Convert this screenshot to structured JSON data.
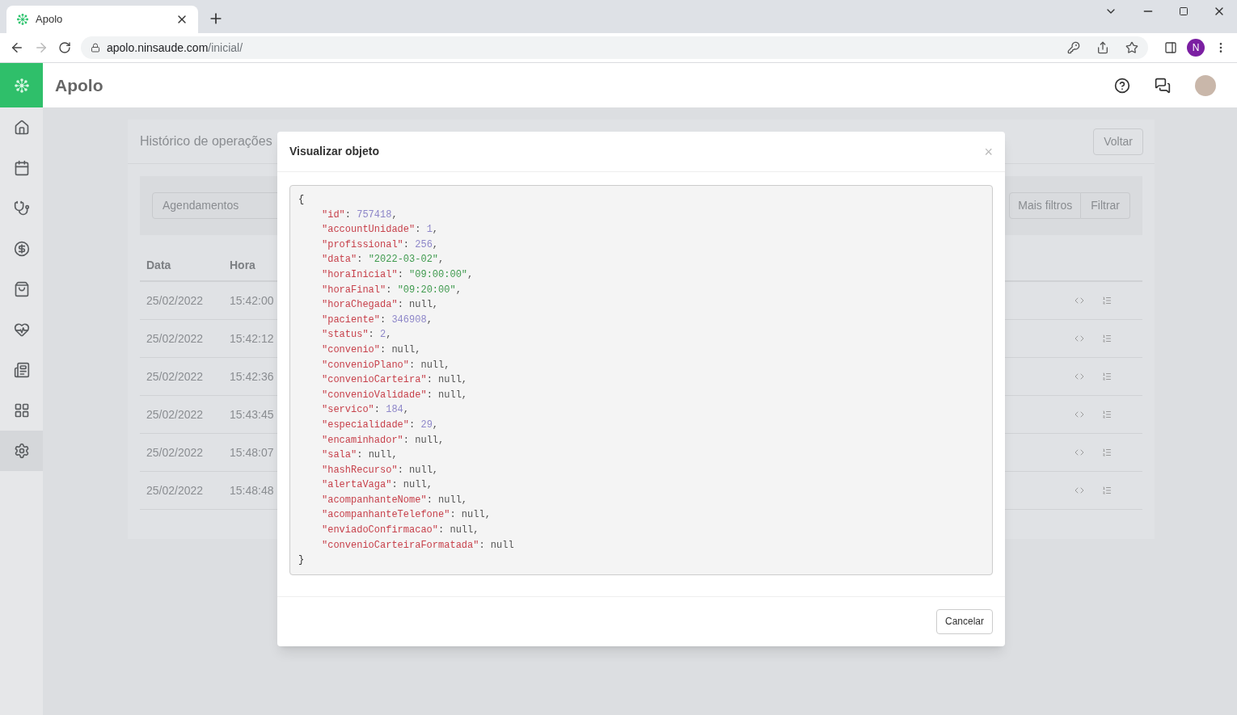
{
  "browser": {
    "tab": {
      "title": "Apolo",
      "selected": true
    },
    "url_host": "apolo.ninsaude.com",
    "url_path": "/inicial/",
    "profile_initial": "N"
  },
  "app": {
    "name": "Apolo"
  },
  "sidebar": {
    "items": [
      {
        "kind": "home",
        "selected": false
      },
      {
        "kind": "calendar",
        "selected": false
      },
      {
        "kind": "stethoscope",
        "selected": false
      },
      {
        "kind": "dollar",
        "selected": false
      },
      {
        "kind": "bag",
        "selected": false
      },
      {
        "kind": "heart",
        "selected": false
      },
      {
        "kind": "news",
        "selected": false
      },
      {
        "kind": "grid",
        "selected": false
      },
      {
        "kind": "settings",
        "selected": true
      }
    ]
  },
  "page": {
    "title": "Histórico de operações",
    "back_button": "Voltar",
    "filter_select": "Agendamentos",
    "more_filters_button": "Mais filtros",
    "filter_button": "Filtrar",
    "table": {
      "columns": [
        "Data",
        "Hora"
      ],
      "rows": [
        {
          "date": "25/02/2022",
          "time": "15:42:00"
        },
        {
          "date": "25/02/2022",
          "time": "15:42:12"
        },
        {
          "date": "25/02/2022",
          "time": "15:42:36"
        },
        {
          "date": "25/02/2022",
          "time": "15:43:45"
        },
        {
          "date": "25/02/2022",
          "time": "15:48:07"
        },
        {
          "date": "25/02/2022",
          "time": "15:48:48"
        }
      ]
    }
  },
  "modal": {
    "title": "Visualizar objeto",
    "close": "×",
    "cancel_button": "Cancelar",
    "open": "{",
    "close_brace": "}",
    "lines": [
      {
        "key": "\"id\"",
        "sep": ":",
        "value": "757418",
        "kind": "number",
        "end": ","
      },
      {
        "key": "\"accountUnidade\"",
        "sep": ":",
        "value": "1",
        "kind": "number",
        "end": ","
      },
      {
        "key": "\"profissional\"",
        "sep": ":",
        "value": "256",
        "kind": "number",
        "end": ","
      },
      {
        "key": "\"data\"",
        "sep": ":",
        "value": "\"2022-03-02\"",
        "kind": "string",
        "end": ","
      },
      {
        "key": "\"horaInicial\"",
        "sep": ":",
        "value": "\"09:00:00\"",
        "kind": "string",
        "end": ","
      },
      {
        "key": "\"horaFinal\"",
        "sep": ":",
        "value": "\"09:20:00\"",
        "kind": "string",
        "end": ","
      },
      {
        "key": "\"horaChegada\"",
        "sep": ":",
        "value": "null",
        "kind": "null",
        "end": ","
      },
      {
        "key": "\"paciente\"",
        "sep": ":",
        "value": "346908",
        "kind": "number",
        "end": ","
      },
      {
        "key": "\"status\"",
        "sep": ":",
        "value": "2",
        "kind": "number",
        "end": ","
      },
      {
        "key": "\"convenio\"",
        "sep": ":",
        "value": "null",
        "kind": "null",
        "end": ","
      },
      {
        "key": "\"convenioPlano\"",
        "sep": ":",
        "value": "null",
        "kind": "null",
        "end": ","
      },
      {
        "key": "\"convenioCarteira\"",
        "sep": ":",
        "value": "null",
        "kind": "null",
        "end": ","
      },
      {
        "key": "\"convenioValidade\"",
        "sep": ":",
        "value": "null",
        "kind": "null",
        "end": ","
      },
      {
        "key": "\"servico\"",
        "sep": ":",
        "value": "184",
        "kind": "number",
        "end": ","
      },
      {
        "key": "\"especialidade\"",
        "sep": ":",
        "value": "29",
        "kind": "number",
        "end": ","
      },
      {
        "key": "\"encaminhador\"",
        "sep": ":",
        "value": "null",
        "kind": "null",
        "end": ","
      },
      {
        "key": "\"sala\"",
        "sep": ":",
        "value": "null",
        "kind": "null",
        "end": ","
      },
      {
        "key": "\"hashRecurso\"",
        "sep": ":",
        "value": "null",
        "kind": "null",
        "end": ","
      },
      {
        "key": "\"alertaVaga\"",
        "sep": ":",
        "value": "null",
        "kind": "null",
        "end": ","
      },
      {
        "key": "\"acompanhanteNome\"",
        "sep": ":",
        "value": "null",
        "kind": "null",
        "end": ","
      },
      {
        "key": "\"acompanhanteTelefone\"",
        "sep": ":",
        "value": "null",
        "kind": "null",
        "end": ","
      },
      {
        "key": "\"enviadoConfirmacao\"",
        "sep": ":",
        "value": "null",
        "kind": "null",
        "end": ","
      },
      {
        "key": "\"convenioCarteiraFormatada\"",
        "sep": ":",
        "value": "null",
        "kind": "null"
      }
    ]
  }
}
